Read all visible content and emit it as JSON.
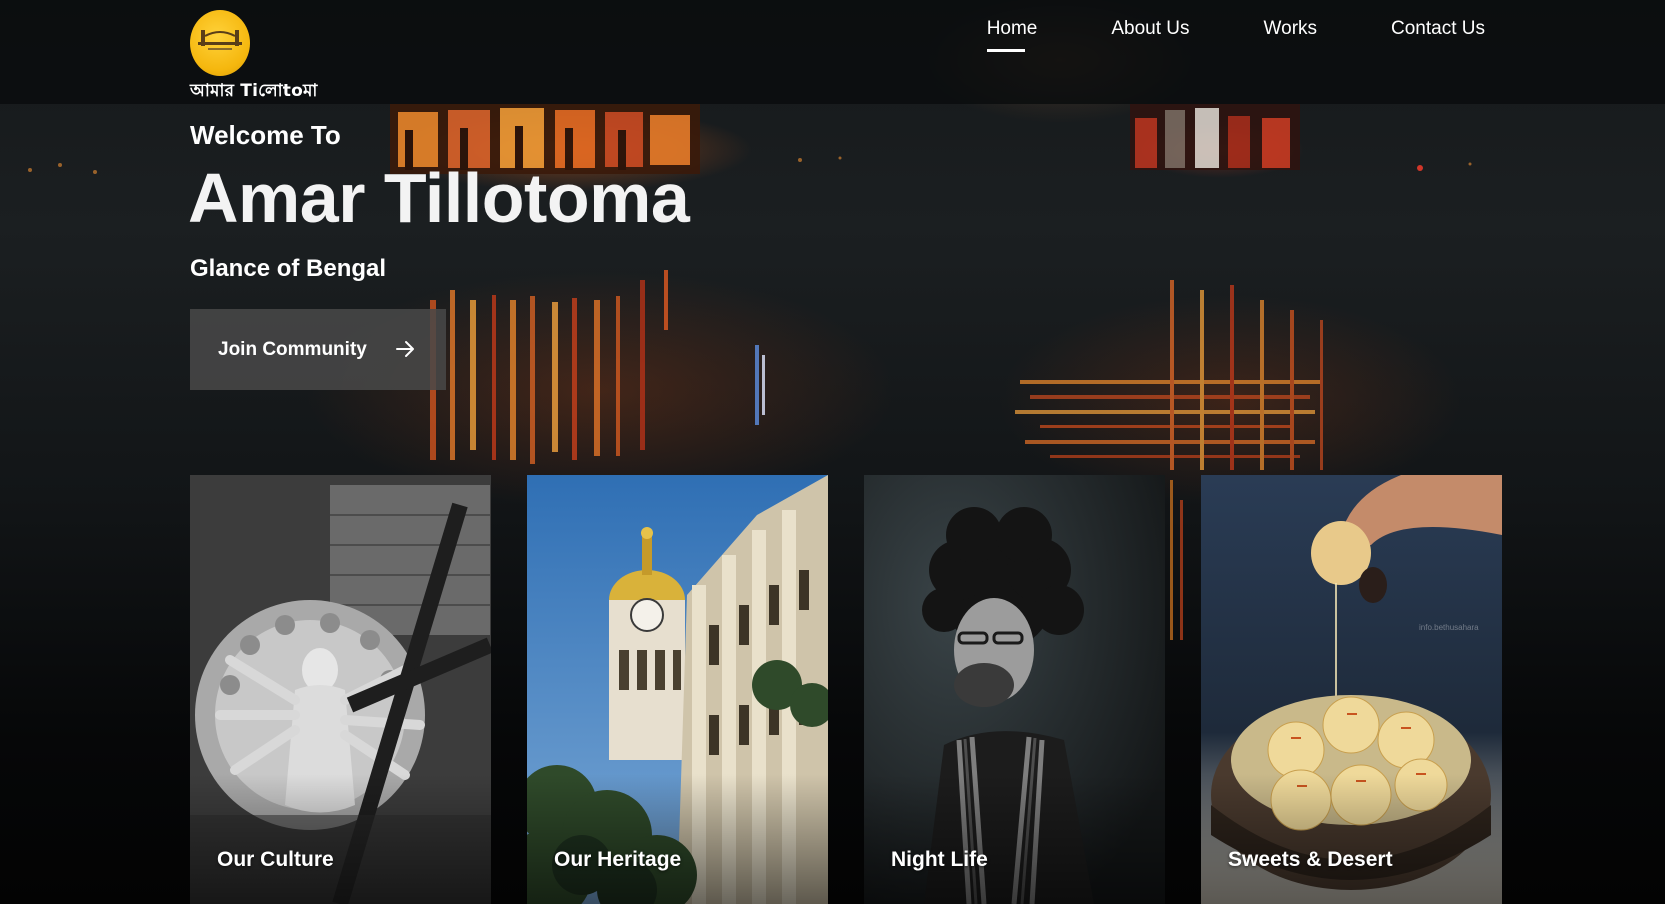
{
  "brand": {
    "logo_text": "আমার Tiলোtoমা"
  },
  "nav": {
    "items": [
      {
        "label": "Home",
        "active": true
      },
      {
        "label": "About Us",
        "active": false
      },
      {
        "label": "Works",
        "active": false
      },
      {
        "label": "Contact Us",
        "active": false
      }
    ]
  },
  "hero": {
    "welcome": "Welcome To",
    "title": "Amar Tillotoma",
    "subtitle": "Glance of Bengal",
    "cta_label": "Join Community",
    "cta_icon": "arrow-right-icon"
  },
  "cards": [
    {
      "label": "Our Culture",
      "image": "durga-idol-photo"
    },
    {
      "label": "Our Heritage",
      "image": "colonial-building-clock-tower-photo"
    },
    {
      "label": "Night Life",
      "image": "musician-portrait-photo"
    },
    {
      "label": "Sweets & Desert",
      "image": "rasgulla-bowl-photo",
      "watermark": "info.bethusahara"
    }
  ],
  "colors": {
    "logo_yellow": "#f5b70e",
    "cta_bg": "#484848",
    "heritage_sky": "#2f6fb4"
  }
}
